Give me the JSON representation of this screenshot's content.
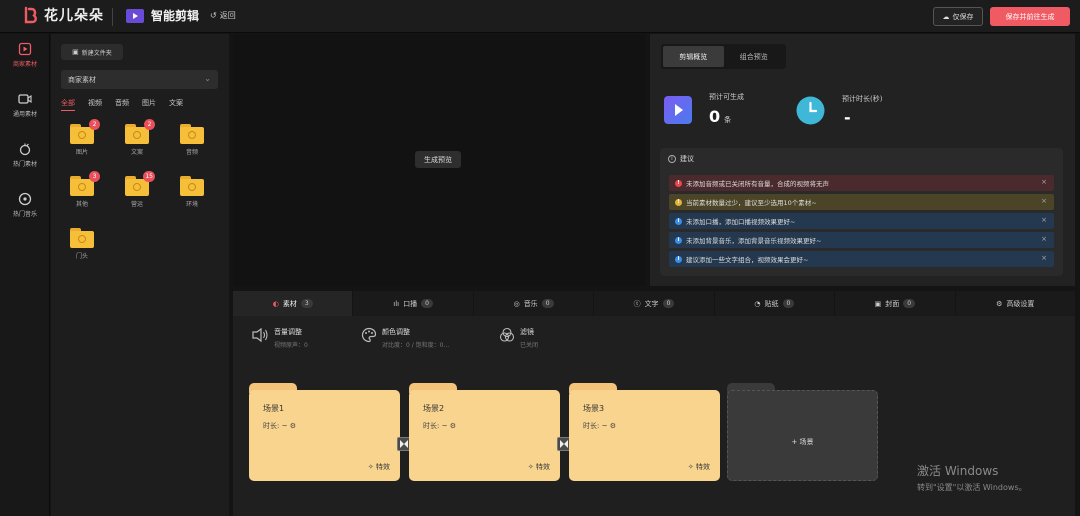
{
  "app": {
    "brand": "花儿朵朵",
    "module": "智能剪辑",
    "back": "返回"
  },
  "header": {
    "save_label": "仅保存",
    "save_generate_label": "保存并前往生成"
  },
  "leftnav": [
    {
      "label": "商家素材",
      "icon": "store-media-icon",
      "active": true
    },
    {
      "label": "通用素材",
      "icon": "video-camera-icon",
      "active": false
    },
    {
      "label": "热门素材",
      "icon": "fire-icon",
      "active": false
    },
    {
      "label": "热门音乐",
      "icon": "music-disc-icon",
      "active": false
    }
  ],
  "material": {
    "new_folder": "新建文件夹",
    "select_value": "商家素材",
    "filters": [
      "全部",
      "视频",
      "音频",
      "图片",
      "文案"
    ],
    "folders": [
      {
        "name": "图片",
        "badge": "2"
      },
      {
        "name": "文案",
        "badge": "2"
      },
      {
        "name": "音频",
        "badge": ""
      },
      {
        "name": "其他",
        "badge": "3"
      },
      {
        "name": "营运",
        "badge": "15"
      },
      {
        "name": "环境",
        "badge": ""
      },
      {
        "name": "门头",
        "badge": ""
      }
    ]
  },
  "preview": {
    "generate_label": "生成预览"
  },
  "right": {
    "tabs": [
      "剪辑概览",
      "组合预览"
    ],
    "stat1": {
      "label": "预计可生成",
      "value": "0",
      "unit": "条"
    },
    "stat2": {
      "label": "预计时长(秒)",
      "value": "-"
    },
    "suggest_title": "建议",
    "suggestions": [
      {
        "text": "未添加音频或已关闭所有音量，合成的视频将无声",
        "level": "error",
        "color": "#4a2a2c"
      },
      {
        "text": "当前素材数量过少，建议至少选用10个素材~",
        "level": "warning",
        "color": "#4c4427"
      },
      {
        "text": "未添加口播，添加口播视频效果更好~",
        "level": "info",
        "color": "#24384f"
      },
      {
        "text": "未添加背景音乐，添加背景音乐视频效果更好~",
        "level": "info",
        "color": "#24384f"
      },
      {
        "text": "建议添加一些文字组合，视频效果会更好~",
        "level": "info",
        "color": "#24384f"
      }
    ]
  },
  "bottom": {
    "tabs": [
      {
        "label": "素材",
        "count": "3"
      },
      {
        "label": "口播",
        "count": "0"
      },
      {
        "label": "音乐",
        "count": "0"
      },
      {
        "label": "文字",
        "count": "0"
      },
      {
        "label": "贴纸",
        "count": "0"
      },
      {
        "label": "封面",
        "count": "0"
      },
      {
        "label": "高级设置",
        "count": ""
      }
    ],
    "tools": [
      {
        "title": "音量调整",
        "sub": "视频原声：0"
      },
      {
        "title": "颜色调整",
        "sub": "对比度：0 / 饱和度：0..."
      },
      {
        "title": "滤镜",
        "sub": "已关闭"
      }
    ],
    "scenes": [
      {
        "name": "场景1",
        "duration": "时长: ~",
        "fx": "特效"
      },
      {
        "name": "场景2",
        "duration": "时长: ~",
        "fx": "特效"
      },
      {
        "name": "场景3",
        "duration": "时长: ~",
        "fx": "特效"
      }
    ],
    "add_scene": "+ 场景"
  },
  "watermark": {
    "line1": "激活 Windows",
    "line2": "转到\"设置\"以激活 Windows。"
  }
}
